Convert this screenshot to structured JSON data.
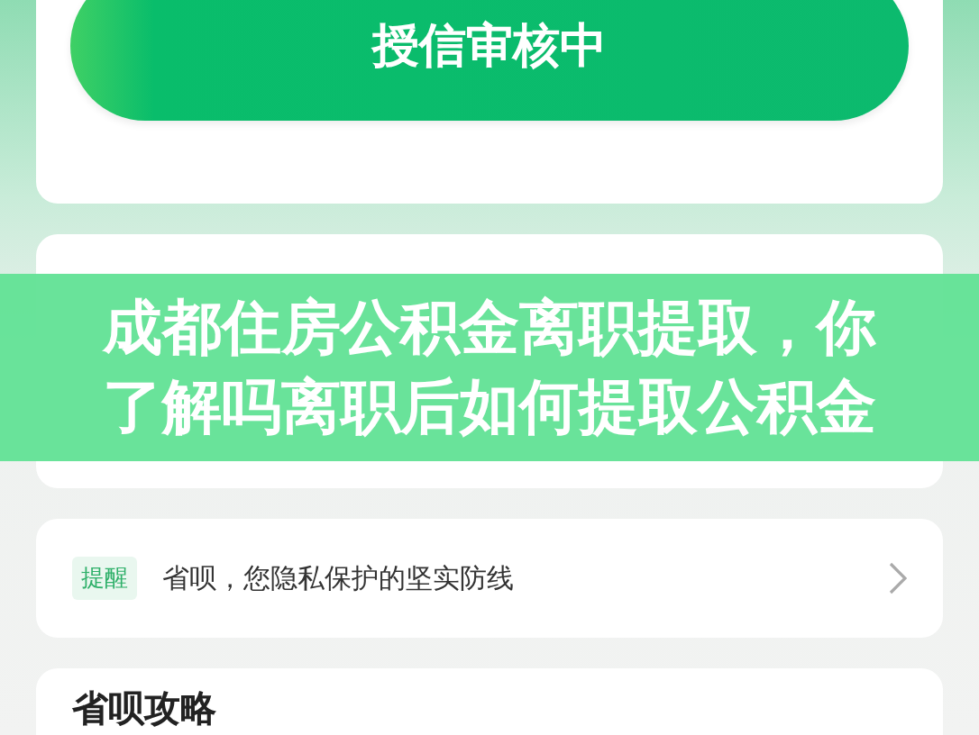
{
  "status_card": {
    "button": "授信审核中"
  },
  "overlay_title": {
    "lines": [
      "成都住房公积金离职提取，你",
      "了解吗离职后如何提取公积金"
    ]
  },
  "notice": {
    "tag": "提醒",
    "text": "省呗，您隐私保护的坚实防线"
  },
  "guide": {
    "title": "省呗攻略"
  }
}
